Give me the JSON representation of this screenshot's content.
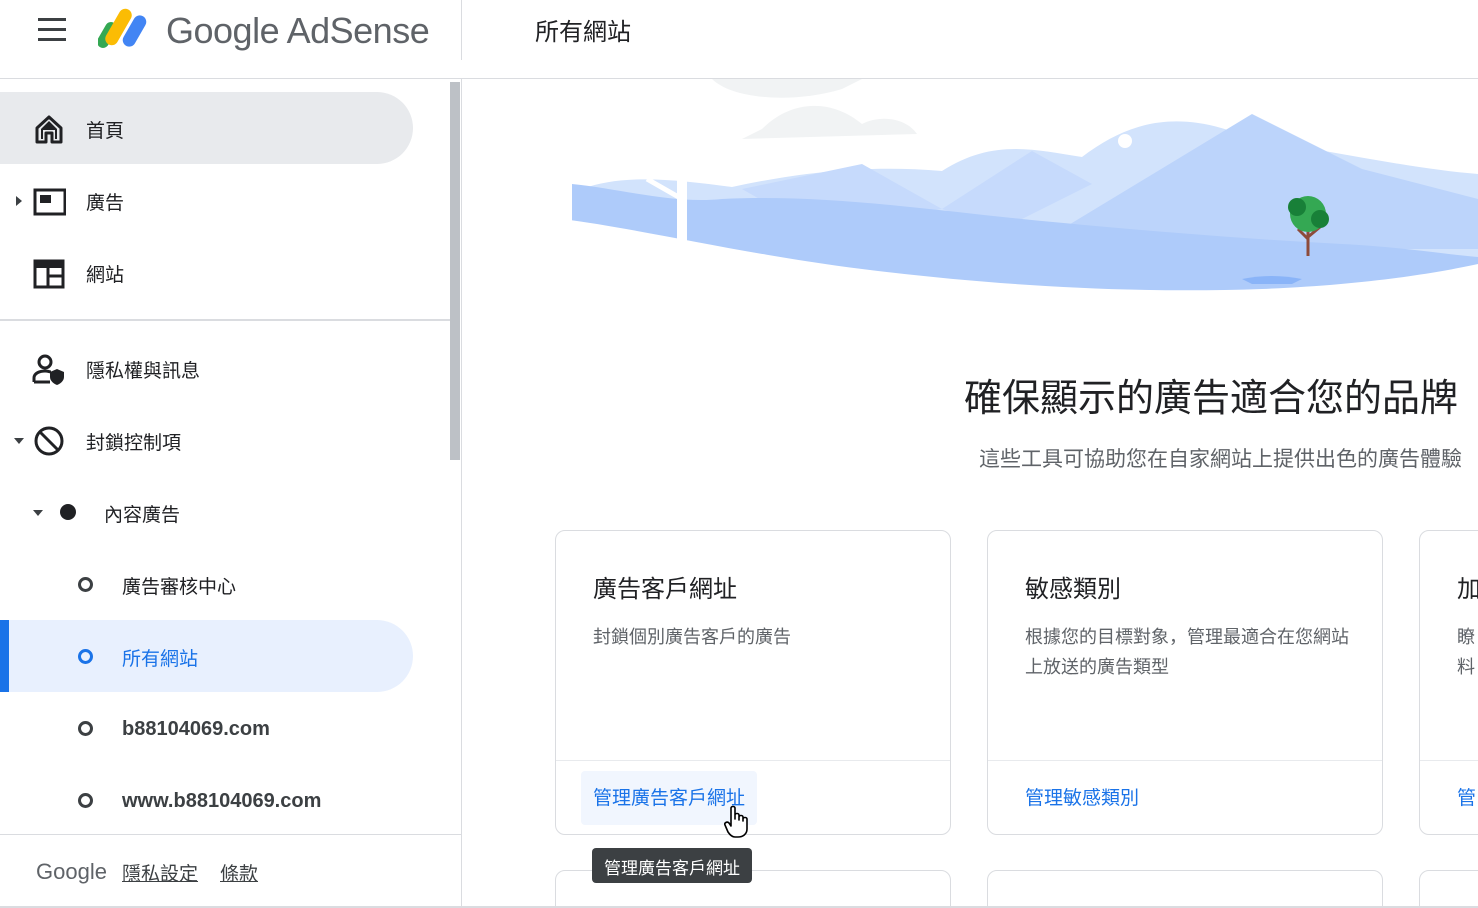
{
  "header": {
    "logo_text": "Google AdSense",
    "page_title": "所有網站"
  },
  "sidebar": {
    "items": [
      {
        "label": "首頁",
        "icon": "home-icon"
      },
      {
        "label": "廣告",
        "icon": "ads-icon"
      },
      {
        "label": "網站",
        "icon": "sites-icon"
      },
      {
        "label": "隱私權與訊息",
        "icon": "privacy-person-icon"
      },
      {
        "label": "封鎖控制項",
        "icon": "block-icon"
      },
      {
        "label": "內容廣告"
      },
      {
        "label": "廣告審核中心"
      },
      {
        "label": "所有網站"
      },
      {
        "label": "b88104069.com"
      },
      {
        "label": "www.b88104069.com"
      }
    ],
    "footer": {
      "google": "Google",
      "privacy": "隱私設定",
      "terms": "條款"
    }
  },
  "main": {
    "headline": "確保顯示的廣告適合您的品牌",
    "subline": "這些工具可協助您在自家網站上提供出色的廣告體驗",
    "cards": [
      {
        "title": "廣告客戶網址",
        "desc": "封鎖個別廣告客戶的廣告",
        "link": "管理廣告客戶網址"
      },
      {
        "title": "敏感類別",
        "desc": "根據您的目標對象，管理最適合在您網站上放送的廣告類型",
        "link": "管理敏感類別"
      },
      {
        "title": "加",
        "desc": "瞭\n料",
        "link": "管"
      }
    ],
    "tooltip": "管理廣告客戶網址"
  },
  "colors": {
    "accent": "#1a73e8",
    "active_bg": "#e8f0fe",
    "home_bg": "#e8eaed",
    "hero_blue": "#aecbfa"
  }
}
